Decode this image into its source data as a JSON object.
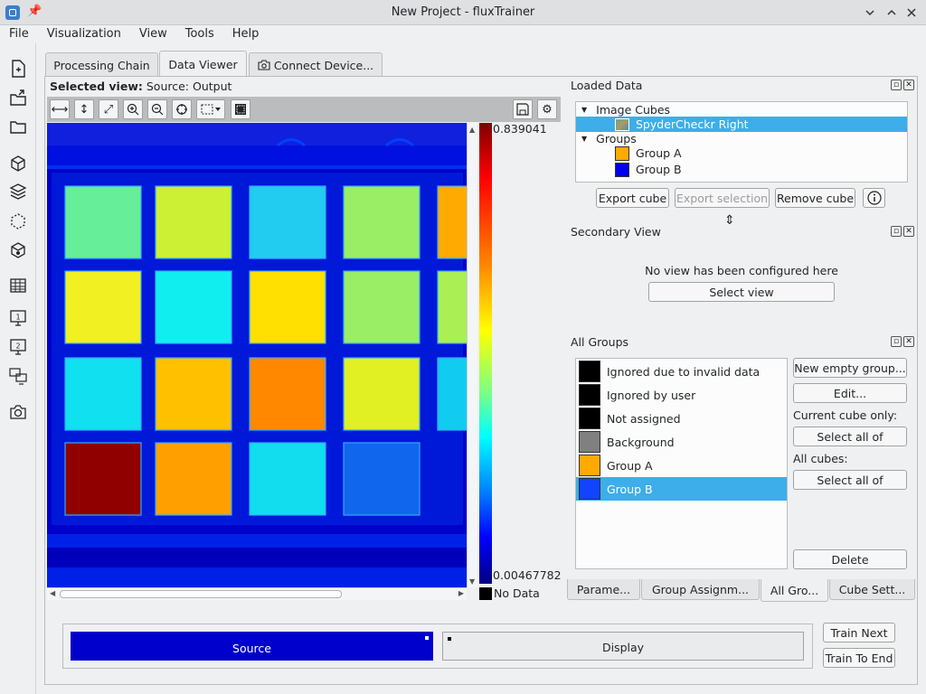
{
  "window": {
    "title": "New Project - fluxTrainer"
  },
  "menu": [
    "File",
    "Visualization",
    "View",
    "Tools",
    "Help"
  ],
  "tabs": [
    {
      "label": "Processing Chain"
    },
    {
      "label": "Data Viewer",
      "active": true
    },
    {
      "label": "Connect Device..."
    }
  ],
  "viewer": {
    "selected_view_label": "Selected view:",
    "selected_view_value": "Source: Output",
    "colorbar": {
      "max": "0.839041",
      "min": "0.00467782",
      "nodata": "No Data"
    },
    "patch_colors": [
      [
        "#66ee99",
        "#ccf033",
        "#22ccf0",
        "#99ee66",
        "#ffaa00"
      ],
      [
        "#f0f022",
        "#11eef0",
        "#ffe000",
        "#99ee66",
        "#aaf055"
      ],
      [
        "#11e0f0",
        "#ffc000",
        "#ff8800",
        "#e0f022",
        "#11ccf0"
      ],
      [
        "#900000",
        "#ffa000",
        "#11ddee",
        "#1166ee",
        null
      ]
    ]
  },
  "loaded_data": {
    "title": "Loaded Data",
    "image_cubes_label": "Image Cubes",
    "cube_name": "SpyderCheckr Right",
    "groups_label": "Groups",
    "groups": [
      {
        "name": "Group A",
        "color": "#ffaa00"
      },
      {
        "name": "Group B",
        "color": "#0000ee"
      }
    ],
    "buttons": {
      "export_cube": "Export cube",
      "export_selection": "Export selection",
      "remove_cube": "Remove cube"
    }
  },
  "secondary_view": {
    "title": "Secondary View",
    "message": "No view has been configured here",
    "select_view": "Select view"
  },
  "all_groups": {
    "title": "All Groups",
    "items": [
      {
        "name": "Ignored due to invalid data",
        "color": "#000000"
      },
      {
        "name": "Ignored by user",
        "color": "#000000"
      },
      {
        "name": "Not assigned",
        "color": "#000000"
      },
      {
        "name": "Background",
        "color": "#808080"
      },
      {
        "name": "Group A",
        "color": "#ffaa00"
      },
      {
        "name": "Group B",
        "color": "#1144ff",
        "selected": true
      }
    ],
    "buttons": {
      "new_empty_group": "New empty group...",
      "edit": "Edit...",
      "current_cube_label": "Current cube only:",
      "select_all_current": "Select all of",
      "all_cubes_label": "All cubes:",
      "select_all_cubes": "Select all of",
      "delete": "Delete"
    }
  },
  "bottom_tabs": [
    {
      "label": "Parame..."
    },
    {
      "label": "Group Assignm..."
    },
    {
      "label": "All Gro...",
      "active": true
    },
    {
      "label": "Cube Sett..."
    }
  ],
  "bottom": {
    "source": "Source",
    "display": "Display",
    "train_next": "Train Next",
    "train_to_end": "Train To End"
  },
  "colors": {
    "accent": "#3daee9",
    "source_blue": "#0000cc"
  }
}
